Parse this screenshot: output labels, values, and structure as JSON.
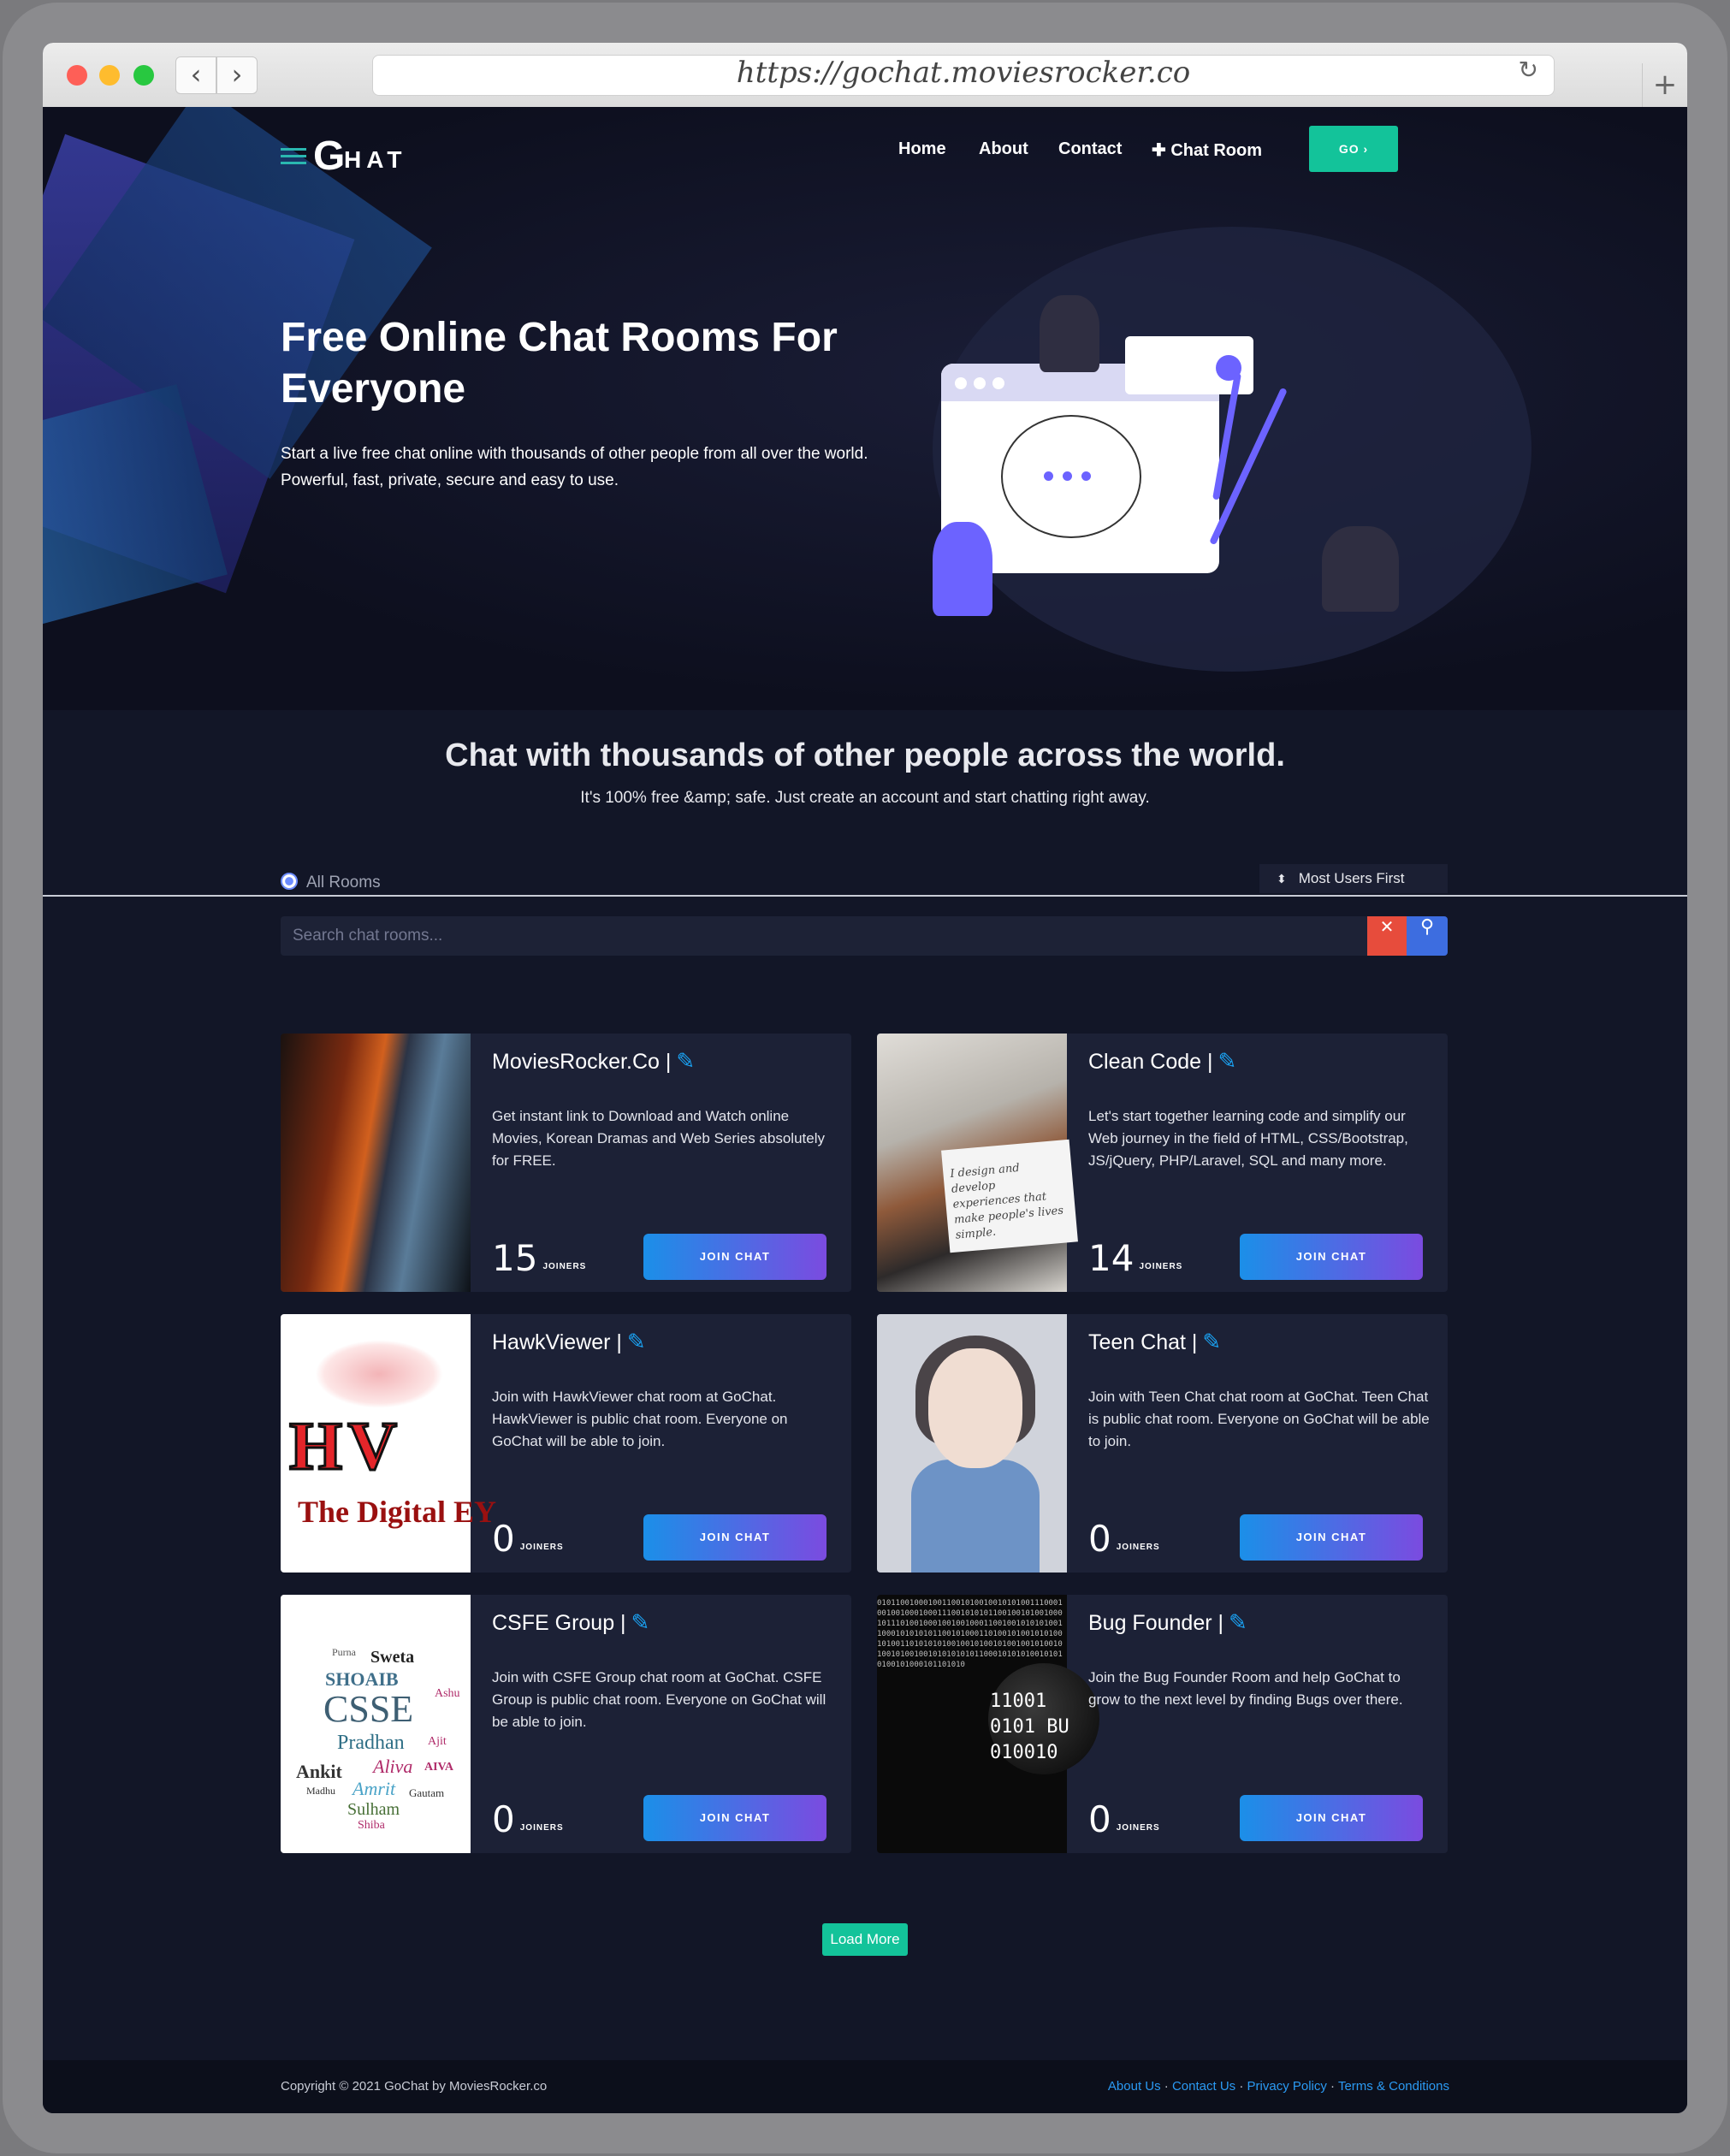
{
  "browser": {
    "url": "https://gochat.moviesrocker.co"
  },
  "header": {
    "logo_g": "G",
    "logo_rest": "HAT",
    "nav": [
      "Home",
      "About",
      "Contact",
      "Chat Room"
    ],
    "go_label": "GO ›"
  },
  "hero": {
    "title": "Free Online Chat Rooms For Everyone",
    "text": "Start a live free chat online with thousands of other people from all over the world. Powerful, fast, private, secure and easy to use."
  },
  "section": {
    "title": "Chat with thousands of other people across the world.",
    "subtitle": "It's 100% free &amp; safe. Just create an account and start chatting right away."
  },
  "filters": {
    "all_rooms": "All Rooms",
    "sort": "Most Users First",
    "search_placeholder": "Search chat rooms..."
  },
  "rooms": [
    {
      "name": "MoviesRocker.Co |",
      "description": "Get instant link to Download and Watch online Movies, Korean Dramas and Web Series absolutely for FREE.",
      "count": "15",
      "joiners_label": "JOINERS",
      "join_label": "JOIN CHAT"
    },
    {
      "name": "Clean Code |",
      "description": "Let's start together learning code and simplify our Web journey in the field of HTML, CSS/Bootstrap, JS/jQuery, PHP/Laravel, SQL and many more.",
      "count": "14",
      "joiners_label": "JOINERS",
      "join_label": "JOIN CHAT"
    },
    {
      "name": "HawkViewer |",
      "description": "Join with HawkViewer chat room at GoChat. HawkViewer is public chat room. Everyone on GoChat will be able to join.",
      "count": "0",
      "joiners_label": "JOINERS",
      "join_label": "JOIN CHAT"
    },
    {
      "name": "Teen Chat |",
      "description": "Join with Teen Chat chat room at GoChat. Teen Chat is public chat room. Everyone on GoChat will be able to join.",
      "count": "0",
      "joiners_label": "JOINERS",
      "join_label": "JOIN CHAT"
    },
    {
      "name": "CSFE Group |",
      "description": "Join with CSFE Group chat room at GoChat. CSFE Group is public chat room. Everyone on GoChat will be able to join.",
      "count": "0",
      "joiners_label": "JOINERS",
      "join_label": "JOIN CHAT"
    },
    {
      "name": "Bug Founder |",
      "description": "Join the Bug Founder Room and help GoChat to grow to the next level by finding Bugs over there.",
      "count": "0",
      "joiners_label": "JOINERS",
      "join_label": "JOIN CHAT"
    }
  ],
  "thumb_text": {
    "clean_code": "I design and develop experiences that make people's lives simple.",
    "hawkviewer_logo": "HV",
    "hawkviewer_tagline": "The Digital EY",
    "csfe_words": [
      "Sweta",
      "SHOAIB",
      "CSSE",
      "Pradhan",
      "Aliva",
      "Ankit",
      "Amrit",
      "Sulham",
      "Gautam",
      "Purna",
      "Ashu",
      "Ajit",
      "AIVA",
      "Shiba",
      "Madhu"
    ],
    "bug_binary": "0101100100010011001010010010101001110001001001000100011100101010110010010100100010111010010001001001000110010010101010011000101010101100101000110100101001010100101001101010101001001010010100100101001010010100100101010101011000101010100101010100101000101101010",
    "bug_lens": "11001\n0101 BU\n010010"
  },
  "load_more": "Load More",
  "footer": {
    "copyright": "Copyright © 2021 GoChat by MoviesRocker.co",
    "links": [
      "About Us",
      "Contact Us",
      "Privacy Policy",
      "Terms & Conditions"
    ],
    "separator": " · "
  }
}
